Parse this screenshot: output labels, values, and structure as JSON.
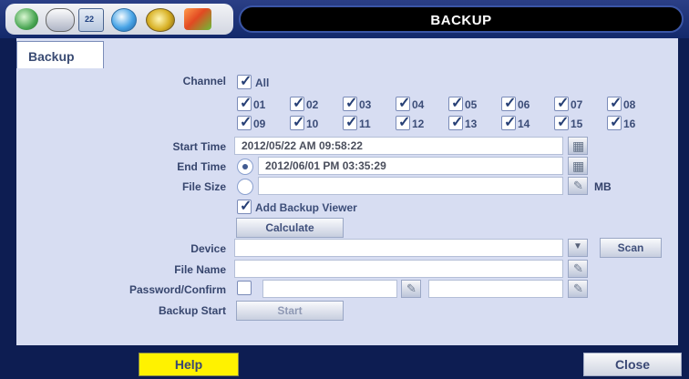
{
  "window": {
    "title": "BACKUP"
  },
  "tabs": [
    {
      "label": "Backup"
    }
  ],
  "channels": {
    "label": "Channel",
    "all_label": "All",
    "items": [
      "01",
      "02",
      "03",
      "04",
      "05",
      "06",
      "07",
      "08",
      "09",
      "10",
      "11",
      "12",
      "13",
      "14",
      "15",
      "16"
    ]
  },
  "form": {
    "start_time_label": "Start Time",
    "start_time_value": "2012/05/22 AM 09:58:22",
    "end_time_label": "End Time",
    "end_time_value": "2012/06/01 PM 03:35:29",
    "file_size_label": "File Size",
    "file_size_unit": "MB",
    "add_viewer_label": "Add Backup Viewer",
    "calculate_label": "Calculate",
    "device_label": "Device",
    "scan_label": "Scan",
    "file_name_label": "File Name",
    "password_label": "Password/Confirm",
    "backup_start_label": "Backup Start",
    "start_label": "Start"
  },
  "footer": {
    "help_label": "Help",
    "close_label": "Close"
  },
  "icons": [
    "disk-icon",
    "toggle-icon",
    "calendar-icon",
    "globe-icon",
    "backup-icon",
    "tools-icon"
  ],
  "colors": {
    "accent": "#fff200",
    "panel": "#d7ddf2",
    "frame": "#0d1d52"
  }
}
